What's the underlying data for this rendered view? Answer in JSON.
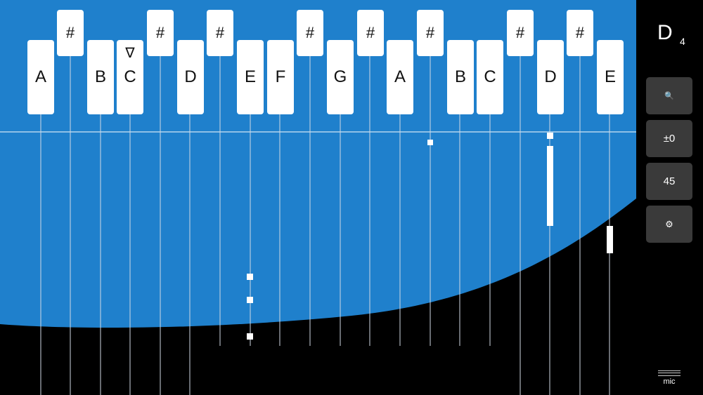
{
  "colors": {
    "blue": "#1f80cc",
    "black": "#000000",
    "line": "#ffffff",
    "button": "#3a3a3a"
  },
  "keys": {
    "k1": {
      "label": "A"
    },
    "k2": {
      "label": "#"
    },
    "k3": {
      "label": "B"
    },
    "k4": {
      "label": "C",
      "marker": "∇"
    },
    "k5": {
      "label": "#"
    },
    "k6": {
      "label": "D"
    },
    "k7": {
      "label": "#"
    },
    "k8": {
      "label": "E"
    },
    "k9": {
      "label": "F"
    },
    "k10": {
      "label": "#"
    },
    "k11": {
      "label": "G"
    },
    "k12": {
      "label": "#"
    },
    "k13": {
      "label": "A"
    },
    "k14": {
      "label": "#"
    },
    "k15": {
      "label": "B"
    },
    "k16": {
      "label": "C"
    },
    "k17": {
      "label": "D"
    },
    "k18": {
      "label": "#"
    },
    "k19": {
      "label": "#"
    },
    "k20": {
      "label": "E"
    }
  },
  "current_note": {
    "name": "D",
    "octave": "4"
  },
  "sidebar": {
    "search_label": "🔍",
    "transpose_label": "±0",
    "speed_label": "45",
    "settings_label": "⚙"
  },
  "mic": {
    "label": "mic"
  }
}
